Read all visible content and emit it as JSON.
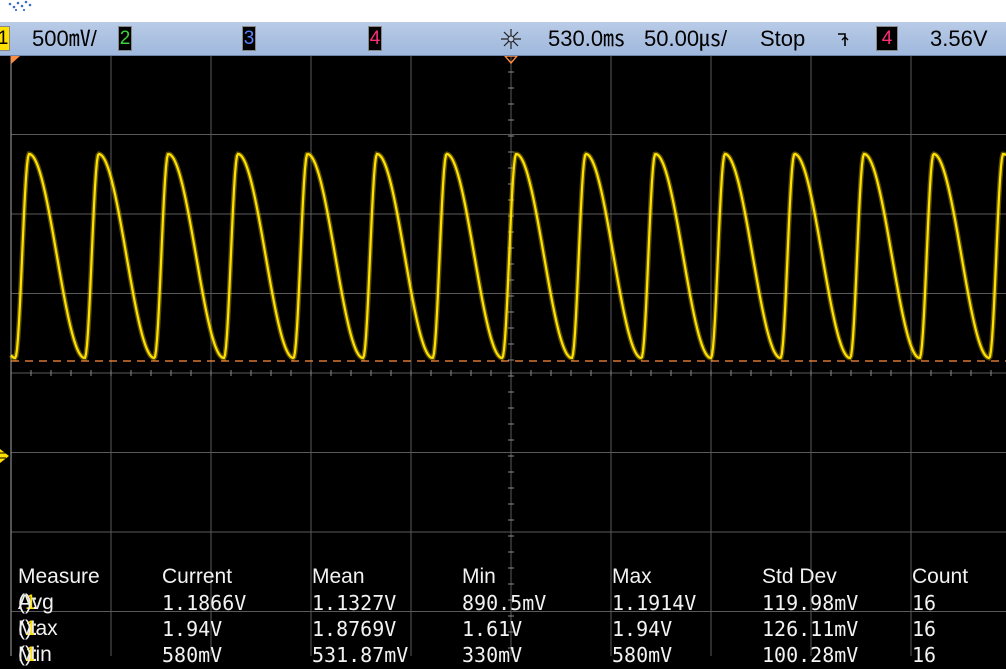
{
  "status_bar": {
    "channels": [
      {
        "number": "1",
        "scale": "500㎷/",
        "color": "#ffe000"
      },
      {
        "number": "2",
        "color": "#3cd23c"
      },
      {
        "number": "3",
        "color": "#5a82ff"
      },
      {
        "number": "4",
        "color": "#ff2d78"
      }
    ],
    "trigger_icon": "trigger-position-icon",
    "time_delay": "530.0㎳",
    "time_scale": "50.00㎲/",
    "run_state": "Stop",
    "trigger_slope_icon": "trigger-slope-icon",
    "trigger_source": "4",
    "trigger_level": "3.56V"
  },
  "screen": {
    "background": "#000000",
    "grid_color": "#5a5a5a",
    "trace_color": "#ffe000",
    "marker_color": "#ff8c3c"
  },
  "waveform": {
    "channel": "1",
    "cycles_per_screen": 14.3,
    "max_v": 1.94,
    "min_v": 0.58
  },
  "measurements": {
    "header": {
      "label": "Measure",
      "current": "Current",
      "mean": "Mean",
      "min": "Min",
      "max": "Max",
      "std_dev": "Std Dev",
      "count": "Count"
    },
    "rows": [
      {
        "stat": "Avg",
        "channel": "1",
        "suffix": "):",
        "current": "1.1866V",
        "mean": "1.1327V",
        "min": "890.5mV",
        "max": "1.1914V",
        "std_dev": "119.98mV",
        "count": "16"
      },
      {
        "stat": "Max",
        "channel": "1",
        "suffix": "):",
        "current": "1.94V",
        "mean": "1.8769V",
        "min": "1.61V",
        "max": "1.94V",
        "std_dev": "126.11mV",
        "count": "16"
      },
      {
        "stat": "Min",
        "channel": "1",
        "suffix": "):",
        "current": "580mV",
        "mean": "531.87mV",
        "min": "330mV",
        "max": "580mV",
        "std_dev": "100.28mV",
        "count": "16"
      }
    ]
  }
}
